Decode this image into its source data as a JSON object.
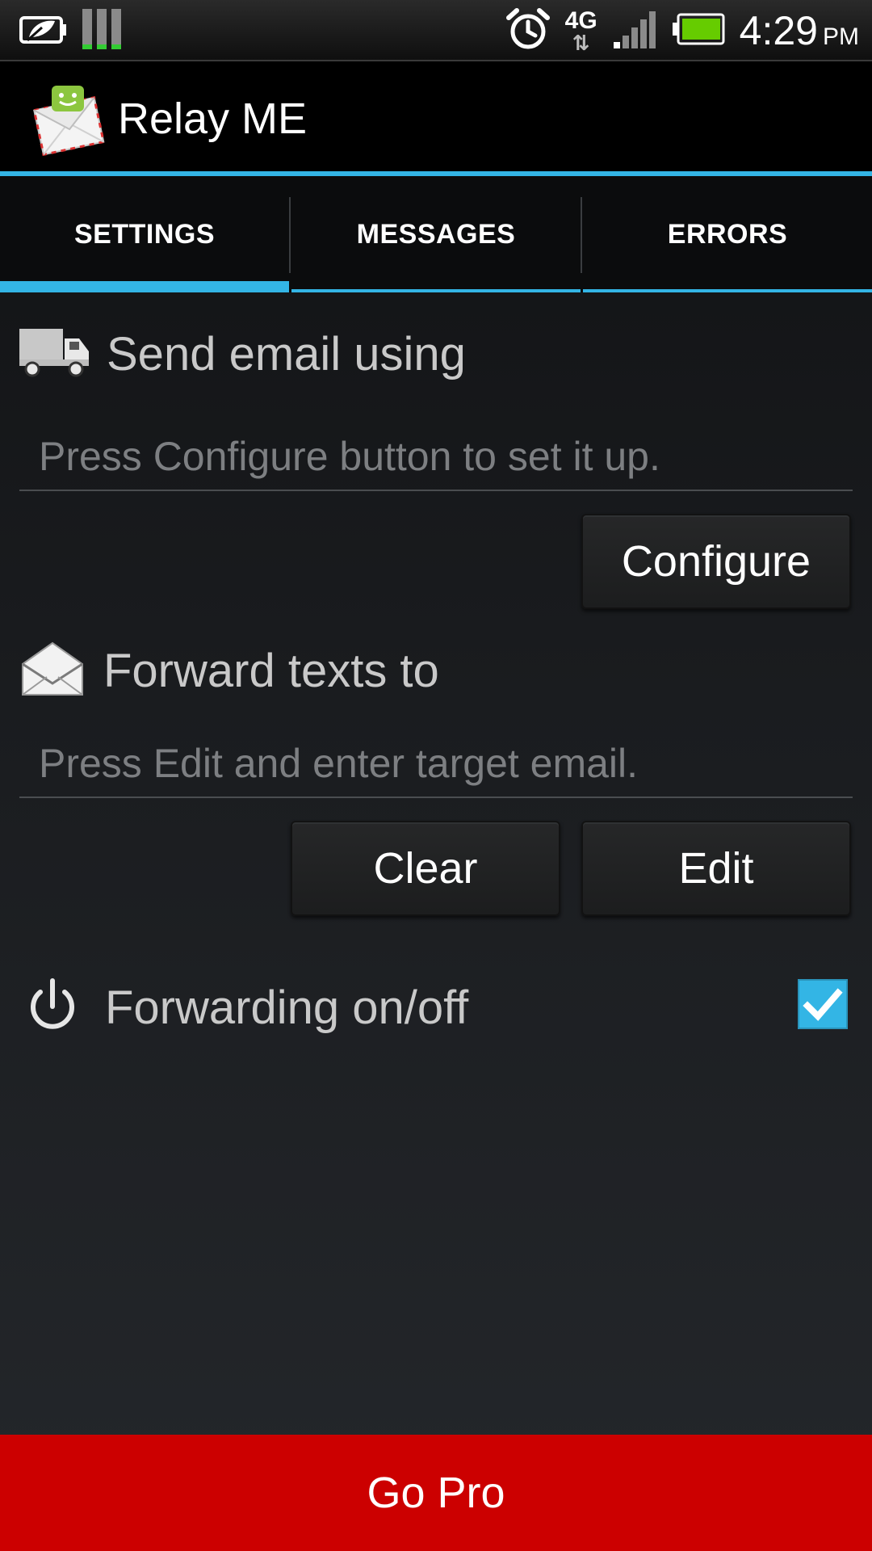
{
  "status_bar": {
    "time": "4:29",
    "ampm": "PM",
    "network": "4G",
    "icons": [
      "power-saver-icon",
      "signal-meter-icon",
      "alarm-icon",
      "network-4g-icon",
      "signal-strength-icon",
      "battery-icon"
    ]
  },
  "app": {
    "title": "Relay ME",
    "icon": "relay-me-app-icon"
  },
  "tabs": [
    {
      "label": "SETTINGS",
      "active": true
    },
    {
      "label": "MESSAGES",
      "active": false
    },
    {
      "label": "ERRORS",
      "active": false
    }
  ],
  "send_email": {
    "header": "Send email using",
    "icon": "truck-icon",
    "placeholder": "Press Configure button to set it up.",
    "configure_label": "Configure"
  },
  "forward": {
    "header": "Forward texts to",
    "icon": "envelope-icon",
    "placeholder": "Press Edit and enter target email.",
    "clear_label": "Clear",
    "edit_label": "Edit"
  },
  "forwarding_toggle": {
    "label": "Forwarding on/off",
    "icon": "power-icon",
    "checked": true
  },
  "footer": {
    "go_pro_label": "Go Pro"
  },
  "colors": {
    "accent": "#33b5e5",
    "go_pro_bg": "#cc0000",
    "battery": "#66cc00"
  }
}
